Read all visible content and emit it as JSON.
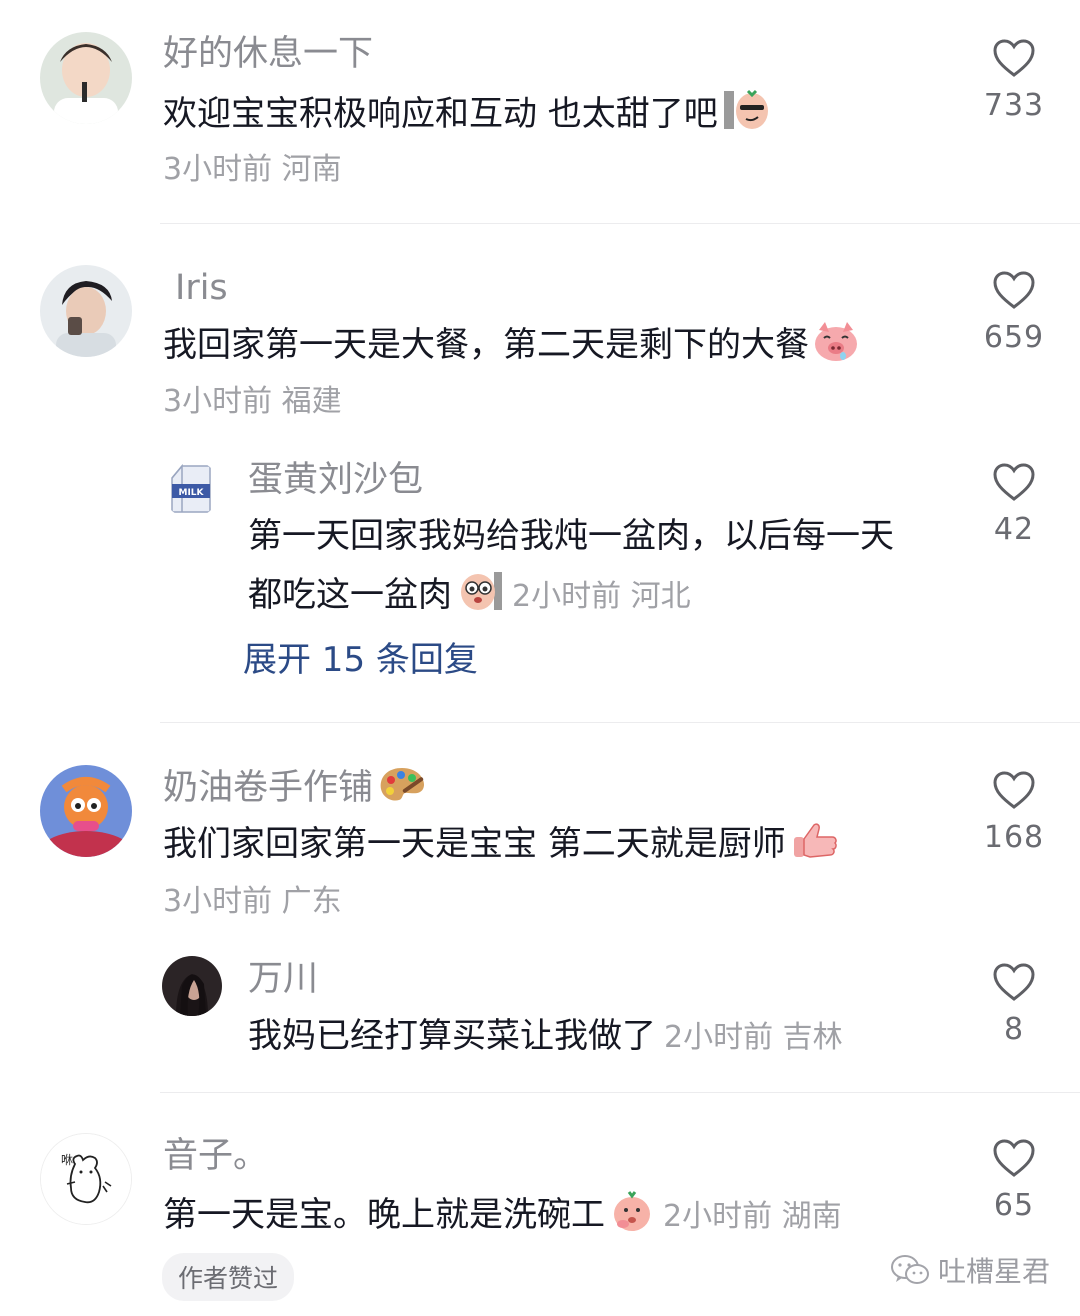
{
  "comments": [
    {
      "username": "好的休息一下",
      "text": "欢迎宝宝积极响应和互动 也太甜了吧",
      "meta": "3小时前 河南",
      "likes": "733"
    },
    {
      "username": "Iris",
      "text": "我回家第一天是大餐，第二天是剩下的大餐",
      "meta": "3小时前 福建",
      "likes": "659",
      "reply": {
        "username": "蛋黄刘沙包",
        "text_line1": "第一天回家我妈给我炖一盆肉，以后每一天",
        "text_line2": "都吃这一盆肉",
        "meta": "2小时前 河北",
        "likes": "42"
      },
      "expand_label": "展开 15 条回复"
    },
    {
      "username": "奶油卷手作铺",
      "text": "我们家回家第一天是宝宝  第二天就是厨师",
      "meta": "3小时前 广东",
      "likes": "168",
      "reply": {
        "username": "万川",
        "text": "我妈已经打算买菜让我做了",
        "meta": "2小时前 吉林",
        "likes": "8"
      }
    },
    {
      "username": "音子。",
      "text": "第一天是宝。晚上就是洗碗工",
      "meta": "2小时前 湖南",
      "likes": "65",
      "author_tag": "作者赞过"
    }
  ],
  "avatar_labels": {
    "milk": "MILK",
    "doodle": "咻"
  },
  "watermark": "吐槽星君",
  "icons": [
    "heart-outline-icon",
    "wechat-icon"
  ]
}
